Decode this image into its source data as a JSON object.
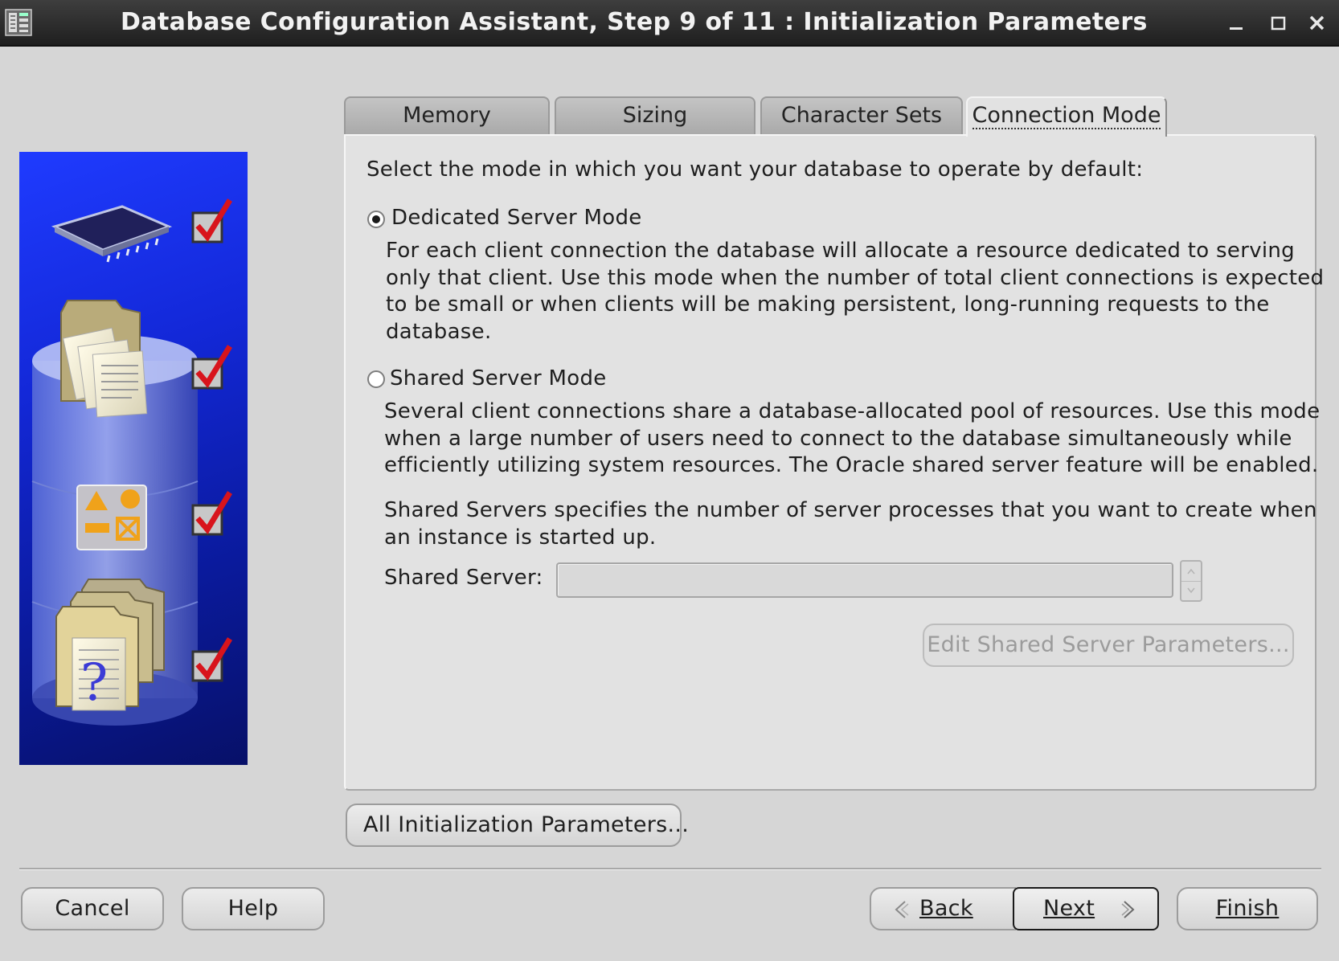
{
  "window": {
    "title": "Database Configuration Assistant, Step 9 of 11 : Initialization Parameters"
  },
  "tabs": [
    {
      "label": "Memory",
      "active": false
    },
    {
      "label": "Sizing",
      "active": false
    },
    {
      "label": "Character Sets",
      "active": false
    },
    {
      "label": "Connection Mode",
      "active": true
    }
  ],
  "connection_mode": {
    "instruction": "Select the mode in which you want your database to operate by default:",
    "dedicated": {
      "label": "Dedicated Server Mode",
      "selected": true,
      "description": [
        "For each client connection the database will allocate a resource dedicated to serving",
        "only that client.  Use this mode when the number of total client connections is expected",
        "to be small or when clients will be making persistent, long-running requests to the",
        "database."
      ]
    },
    "shared": {
      "label": "Shared Server Mode",
      "selected": false,
      "description": [
        "Several client connections share a database-allocated pool of resources.  Use this mode",
        "when a large number of users need to connect to the database simultaneously while",
        "efficiently utilizing system resources.  The Oracle shared server feature will be enabled."
      ],
      "servers_description": [
        "Shared Servers specifies the number of server processes that you want to create when",
        "an instance is started up."
      ],
      "field_label": "Shared Server:",
      "field_value": "",
      "edit_button": "Edit Shared Server Parameters..."
    }
  },
  "all_params_button": "All Initialization Parameters...",
  "footer": {
    "cancel": "Cancel",
    "help": "Help",
    "back": "Back",
    "next": "Next",
    "finish": "Finish"
  },
  "colors": {
    "banner": "#1328d8",
    "check": "#d8141c",
    "titlebar": "#2a2a2a"
  },
  "icons": [
    "database-wizard-icon",
    "minimize-icon",
    "maximize-icon",
    "close-icon",
    "memory-chip-icon",
    "document-folder-icon",
    "shapes-icon",
    "help-document-icon",
    "step-checkmark-icon",
    "back-arrow-icon",
    "next-arrow-icon"
  ]
}
